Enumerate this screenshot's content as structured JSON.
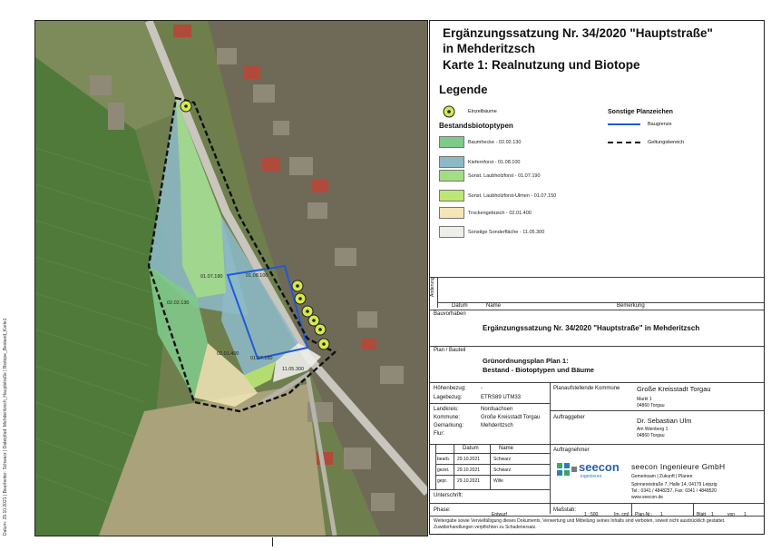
{
  "title": {
    "line1": "Ergänzungssatzung Nr. 34/2020 \"Hauptstraße\"",
    "line2": "in Mehderitzsch",
    "line3": "Karte 1: Realnutzung und Biotope"
  },
  "legend": {
    "heading": "Legende",
    "einzelbaeume": "Einzelbäume",
    "bestand_heading": "Bestandsbiotoptypen",
    "biotopes": [
      {
        "label": "Baumhecke - 02.02.130",
        "color": "#7fc98a"
      },
      {
        "label": "Kiefernforst - 01.08.100",
        "color": "#8db9c7"
      },
      {
        "label": "Sonst. Laubholzforst - 01.07.190",
        "color": "#a4dc86"
      },
      {
        "label": "Sonst. Laubholzforst-Ulmen - 01.07.150",
        "color": "#bde775"
      },
      {
        "label": "Trockengebüsch - 02.01.400",
        "color": "#f5e6b8"
      },
      {
        "label": "Sonstige Sonderfläche - 11.05.300",
        "color": "#ededea"
      }
    ],
    "sonstige_heading": "Sonstige Planzeichen",
    "baugrenze": "Baugrenze",
    "geltungsbereich": "Geltungsbereich"
  },
  "map_labels": {
    "l1": "01.07.190",
    "l2": "01.08.100",
    "l3": "02.02.130",
    "l4": "02.01.400",
    "l5": "01.07.150",
    "l6": "11.05.300"
  },
  "colors": {
    "baugrenze": "#1f5ad6",
    "geltung": "#111111",
    "tree": "#d5e84e"
  },
  "table": {
    "aenderung": "Änderung",
    "datum_h": "Datum",
    "name_h": "Name",
    "bemerkung_h": "Bemerkung",
    "bauvorhaben_label": "Bauvorhaben",
    "bauvorhaben": "Ergänzungssatzung Nr. 34/2020 \"Hauptstraße\" in Mehderitzsch",
    "plan_label": "Plan / Bauteil",
    "plan1": "Grünordnungsplan Plan 1:",
    "plan2": "Bestand - Biotoptypen und Bäume",
    "hoehenbezug_label": "Höhenbezug:",
    "hoehenbezug": "-",
    "lagebezug_label": "Lagebezug:",
    "lagebezug": "ETRS89 UTM33",
    "landkreis_label": "Landkreis:",
    "landkreis": "Nordsachsen",
    "kommune_label": "Kommune:",
    "kommune": "Große Kreisstadt Torgau",
    "gemarkung_label": "Gemarkung:",
    "gemarkung": "Mehderitzsch",
    "flur_label": "Flur:",
    "flur": "",
    "planaufst_label": "Planaufstellende Kommune",
    "planaufst_name": "Große Kreisstadt Torgau",
    "planaufst_addr1": "Markt 1",
    "planaufst_addr2": "04860 Torgau",
    "auftraggeber_label": "Auftraggeber",
    "auftraggeber_name": "Dr. Sebastian Ulm",
    "auftraggeber_addr1": "Am Weinberg 1",
    "auftraggeber_addr2": "04860 Torgau",
    "auftragnehmer_label": "Auftragnehmer",
    "datum_col": "Datum",
    "name_col": "Name",
    "bearb": "bearb.",
    "bearb_date": "29.10.2021",
    "bearb_name": "Schwarz",
    "gezei": "gezei.",
    "gezei_date": "29.10.2021",
    "gezei_name": "Schwarz",
    "gepr": "gepr.",
    "gepr_date": "29.10.2021",
    "gepr_name": "Wille",
    "unterschrift": "Unterschrift:",
    "company": "seecon Ingenieure GmbH",
    "company_sub": "Gemeinsam | Zukunft | Planen",
    "company_addr": "Spinnereistraße 7, Halle 14, 04179 Leipzig",
    "company_tel": "Tel.: 0341 / 4848257, Fax: 0341 / 4848520",
    "company_web": "www.seecon.de",
    "logo_text": "seecon",
    "logo_sub": "ingenieure",
    "phase_label": "Phase:",
    "phase": "Entwurf",
    "massstab_label": "Maßstab:",
    "massstab": "1 : 500",
    "unit": "[m, cm]",
    "plannr_label": "Plan-Nr.:",
    "plannr": "1",
    "blatt_label": "Blatt",
    "blatt": "1",
    "von_label": "von",
    "von": "1",
    "footer": "Weitergabe sowie Vervielfältigung dieses Dokuments, Verwertung und Mitteilung seines Inhalts sind verboten, soweit nicht ausdrücklich gestattet. Zuwiderhandlungen verpflichten zu Schadenersatz."
  },
  "side_text": "Datum: 29.10.2021 | Bearbeiter: Schwarz | Dateipfad: Mehderitzsch_Hauptstraße | Biotope_Bestand_Karte1"
}
